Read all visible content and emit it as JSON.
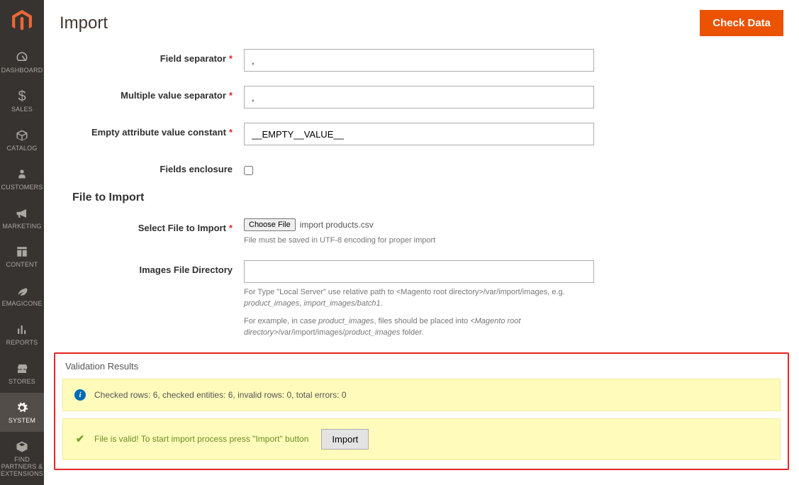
{
  "header": {
    "title": "Import",
    "check_data_label": "Check Data"
  },
  "sidebar": {
    "items": [
      {
        "label": "DASHBOARD",
        "icon": "dashboard"
      },
      {
        "label": "SALES",
        "icon": "dollar"
      },
      {
        "label": "CATALOG",
        "icon": "catalog"
      },
      {
        "label": "CUSTOMERS",
        "icon": "customer"
      },
      {
        "label": "MARKETING",
        "icon": "marketing"
      },
      {
        "label": "CONTENT",
        "icon": "content"
      },
      {
        "label": "EMAGICONE",
        "icon": "leaf"
      },
      {
        "label": "REPORTS",
        "icon": "reports"
      },
      {
        "label": "STORES",
        "icon": "stores"
      },
      {
        "label": "SYSTEM",
        "icon": "gear"
      },
      {
        "label": "FIND PARTNERS & EXTENSIONS",
        "icon": "partners"
      }
    ]
  },
  "form": {
    "field_separator": {
      "label": "Field separator",
      "value": ","
    },
    "multiple_value_separator": {
      "label": "Multiple value separator",
      "value": ","
    },
    "empty_attribute": {
      "label": "Empty attribute value constant",
      "value": "__EMPTY__VALUE__"
    },
    "fields_enclosure": {
      "label": "Fields enclosure"
    },
    "file_to_import_heading": "File to Import",
    "select_file": {
      "label": "Select File to Import",
      "button": "Choose File",
      "filename": "import products.csv",
      "note": "File must be saved in UTF-8 encoding for proper import"
    },
    "images_dir": {
      "label": "Images File Directory",
      "value": "",
      "note1_a": "For Type \"Local Server\" use relative path to <Magento root directory>/var/import/images, e.g. ",
      "note1_i1": "product_images",
      "note1_b": ", ",
      "note1_i2": "import_images/batch1",
      "note1_c": ".",
      "note2_a": "For example, in case ",
      "note2_i1": "product_images",
      "note2_b": ", files should be placed into ",
      "note2_i2": "<Magento root directory>",
      "note2_c": "/var/import/images/",
      "note2_i3": "product_images",
      "note2_d": " folder."
    }
  },
  "validation": {
    "title": "Validation Results",
    "info_msg": "Checked rows: 6, checked entities: 6, invalid rows: 0, total errors: 0",
    "ok_msg": "File is valid! To start import process press \"Import\" button",
    "import_label": "Import"
  }
}
